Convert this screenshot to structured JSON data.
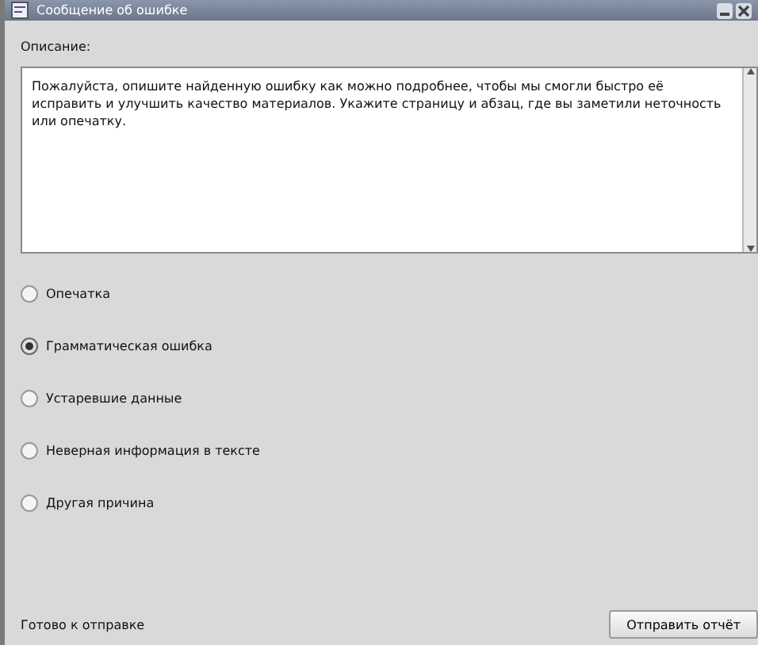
{
  "window": {
    "title": "Сообщение об ошибке"
  },
  "description": {
    "label": "Описание:",
    "value": "Пожалуйста, опишите найденную ошибку как можно подробнее, чтобы мы смогли быстро её исправить и улучшить качество материалов. Укажите страницу и абзац, где вы заметили неточность или опечатку."
  },
  "options": [
    {
      "label": "Опечатка",
      "selected": false
    },
    {
      "label": "Грамматическая ошибка",
      "selected": true
    },
    {
      "label": "Устаревшие данные",
      "selected": false
    },
    {
      "label": "Неверная информация в тексте",
      "selected": false
    },
    {
      "label": "Другая причина",
      "selected": false
    }
  ],
  "status": "Готово к отправке",
  "buttons": [
    "Отправить отчёт"
  ]
}
